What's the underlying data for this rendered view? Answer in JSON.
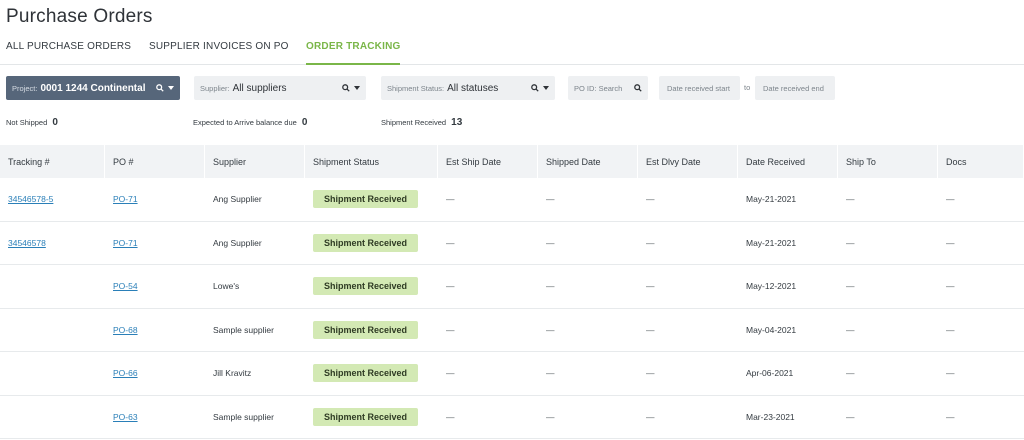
{
  "page": {
    "title": "Purchase Orders"
  },
  "tabs": [
    {
      "label": "ALL PURCHASE ORDERS"
    },
    {
      "label": "SUPPLIER INVOICES ON PO"
    },
    {
      "label": "ORDER TRACKING"
    }
  ],
  "filters": {
    "project": {
      "label": "Project:",
      "value": "0001 1244 Continental"
    },
    "supplier": {
      "label": "Supplier:",
      "value": "All suppliers"
    },
    "shipment_status": {
      "label": "Shipment Status:",
      "value": "All statuses"
    },
    "po_id": {
      "placeholder": "PO ID: Search"
    },
    "date_start": {
      "placeholder": "Date received start"
    },
    "to_label": "to",
    "date_end": {
      "placeholder": "Date received end"
    }
  },
  "summary": {
    "not_shipped": {
      "label": "Not Shipped",
      "value": "0"
    },
    "expected": {
      "label": "Expected to Arrive balance due",
      "value": "0"
    },
    "received": {
      "label": "Shipment Received",
      "value": "13"
    }
  },
  "table": {
    "columns": [
      "Tracking #",
      "PO #",
      "Supplier",
      "Shipment Status",
      "Est Ship Date",
      "Shipped Date",
      "Est Dlvy Date",
      "Date Received",
      "Ship To",
      "Docs"
    ],
    "rows": [
      {
        "tracking": "34546578-5",
        "po": "PO-71",
        "supplier": "Ang Supplier",
        "status": "Shipment Received",
        "est_ship": "—",
        "shipped": "—",
        "est_dlvy": "—",
        "received": "May-21-2021",
        "ship_to": "—",
        "docs": "—"
      },
      {
        "tracking": "34546578",
        "po": "PO-71",
        "supplier": "Ang Supplier",
        "status": "Shipment Received",
        "est_ship": "—",
        "shipped": "—",
        "est_dlvy": "—",
        "received": "May-21-2021",
        "ship_to": "—",
        "docs": "—"
      },
      {
        "tracking": "",
        "po": "PO-54",
        "supplier": "Lowe's",
        "status": "Shipment Received",
        "est_ship": "—",
        "shipped": "—",
        "est_dlvy": "—",
        "received": "May-12-2021",
        "ship_to": "—",
        "docs": "—"
      },
      {
        "tracking": "",
        "po": "PO-68",
        "supplier": "Sample supplier",
        "status": "Shipment Received",
        "est_ship": "—",
        "shipped": "—",
        "est_dlvy": "—",
        "received": "May-04-2021",
        "ship_to": "—",
        "docs": "—"
      },
      {
        "tracking": "",
        "po": "PO-66",
        "supplier": "Jill Kravitz",
        "status": "Shipment Received",
        "est_ship": "—",
        "shipped": "—",
        "est_dlvy": "—",
        "received": "Apr-06-2021",
        "ship_to": "—",
        "docs": "—"
      },
      {
        "tracking": "",
        "po": "PO-63",
        "supplier": "Sample supplier",
        "status": "Shipment Received",
        "est_ship": "—",
        "shipped": "—",
        "est_dlvy": "—",
        "received": "Mar-23-2021",
        "ship_to": "—",
        "docs": "—"
      }
    ]
  },
  "colors": {
    "accent": "#7ab648",
    "badge_bg": "#d3e9b4",
    "link": "#2a7fb8",
    "project_bg": "#56667a"
  },
  "icons": [
    "search-icon",
    "caret-down-icon"
  ]
}
